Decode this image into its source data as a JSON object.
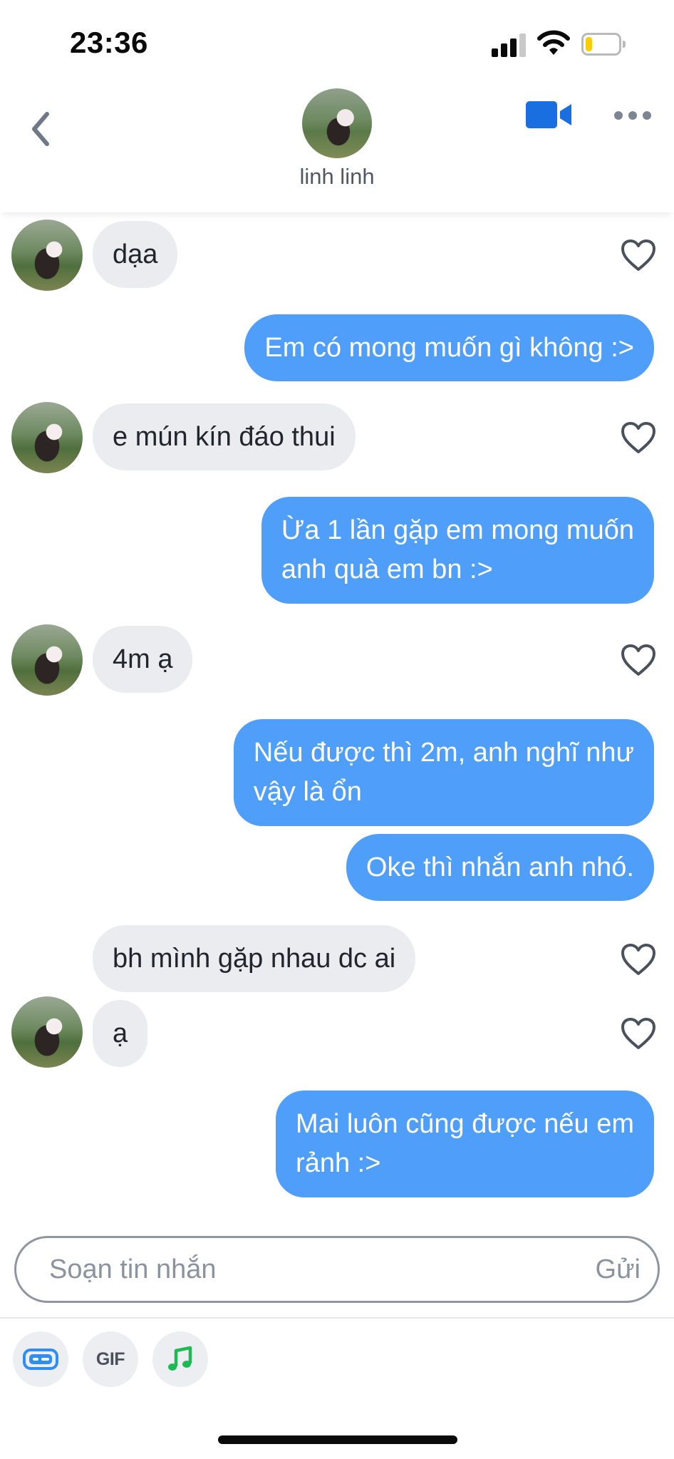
{
  "status_bar": {
    "time": "23:36",
    "battery_level": 0.2,
    "battery_color": "#ffcc00"
  },
  "header": {
    "contact_name": "linh linh",
    "video_icon_color": "#1a6fe0"
  },
  "messages": [
    {
      "side": "incoming",
      "text": "dạa",
      "liked": false
    },
    {
      "side": "outgoing",
      "text": "Em có mong muốn gì không :>"
    },
    {
      "side": "incoming",
      "text": "e mún kín đáo thui",
      "liked": false
    },
    {
      "side": "outgoing",
      "text": "Ừa 1 lần gặp em mong muốn\nanh quà em bn :>"
    },
    {
      "side": "incoming",
      "text": "4m ạ",
      "liked": false
    },
    {
      "side": "outgoing",
      "text": "Nếu được thì 2m, anh nghĩ như\nvậy là ổn"
    },
    {
      "side": "outgoing",
      "text": "Oke thì nhắn anh nhó."
    },
    {
      "side": "incoming",
      "text": "bh mình gặp nhau dc ai",
      "liked": false
    },
    {
      "side": "incoming",
      "text": "ạ",
      "liked": false
    },
    {
      "side": "outgoing",
      "text": "Mai luôn cũng được nếu em\nrảnh :>"
    }
  ],
  "composer": {
    "placeholder": "Soạn tin nhắn",
    "value": "",
    "send_label": "Gửi"
  },
  "toolbar": {
    "gif_label": "GIF",
    "icons": [
      "card-sticker-icon",
      "gif-icon",
      "music-note-icon"
    ]
  },
  "colors": {
    "outgoing_bubble": "#4f9ef9",
    "incoming_bubble": "#ebecf0",
    "music_green": "#1db954"
  }
}
